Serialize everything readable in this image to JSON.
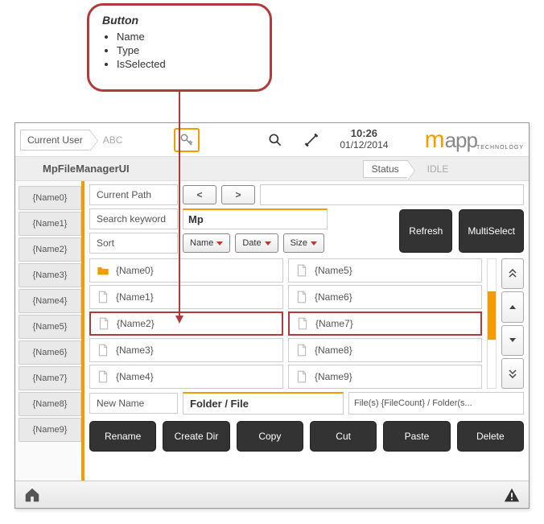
{
  "callout": {
    "title": "Button",
    "items": [
      "Name",
      "Type",
      "IsSelected"
    ]
  },
  "topbar": {
    "user_label": "Current User",
    "user_value": "ABC",
    "time": "10:26",
    "date": "01/12/2014",
    "logo_a": "m",
    "logo_b": "app",
    "logo_c": "TECHNOLOGY"
  },
  "titlebar": {
    "module": "MpFileManagerUI",
    "status_label": "Status",
    "status_value": "IDLE"
  },
  "sidebar": [
    "{Name0}",
    "{Name1}",
    "{Name2}",
    "{Name3}",
    "{Name4}",
    "{Name5}",
    "{Name6}",
    "{Name7}",
    "{Name8}",
    "{Name9}"
  ],
  "labels": {
    "current_path": "Current Path",
    "search": "Search keyword",
    "sort": "Sort",
    "new_name": "New Name"
  },
  "nav": {
    "back": "<",
    "fwd": ">"
  },
  "search_value": "Mp",
  "sort_buttons": [
    "Name",
    "Date",
    "Size"
  ],
  "buttons": {
    "refresh": "Refresh",
    "multiselect": "MultiSelect",
    "rename": "Rename",
    "create_dir": "Create Dir",
    "copy": "Copy",
    "cut": "Cut",
    "paste": "Paste",
    "delete": "Delete"
  },
  "files_left": [
    {
      "name": "{Name0}",
      "type": "folder"
    },
    {
      "name": "{Name1}",
      "type": "file"
    },
    {
      "name": "{Name2}",
      "type": "file",
      "hl": true
    },
    {
      "name": "{Name3}",
      "type": "file"
    },
    {
      "name": "{Name4}",
      "type": "file"
    }
  ],
  "files_right": [
    {
      "name": "{Name5}",
      "type": "file"
    },
    {
      "name": "{Name6}",
      "type": "file"
    },
    {
      "name": "{Name7}",
      "type": "file",
      "hl": true
    },
    {
      "name": "{Name8}",
      "type": "file"
    },
    {
      "name": "{Name9}",
      "type": "file"
    }
  ],
  "new_name_value": "Folder / File",
  "count_text": "File(s) {FileCount} / Folder(s..."
}
